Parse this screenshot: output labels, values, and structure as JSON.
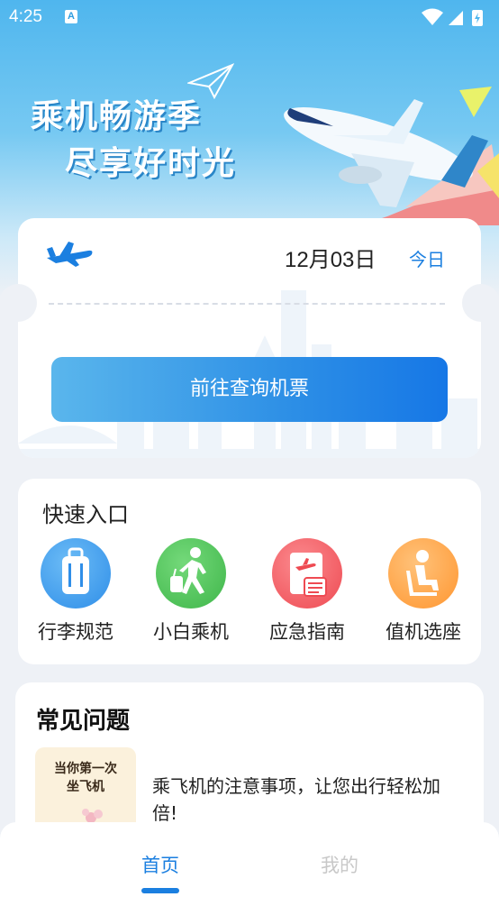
{
  "status_bar": {
    "time": "4:25",
    "notification_badge": "A"
  },
  "banner": {
    "slogan_line1": "乘机畅游季",
    "slogan_line2": "尽享好时光"
  },
  "ticket": {
    "date": "12月03日",
    "today_label": "今日",
    "search_button": "前往查询机票"
  },
  "quick_entry": {
    "title": "快速入口",
    "items": [
      {
        "label": "行李规范",
        "icon": "luggage-icon",
        "color": "#3f9cf0"
      },
      {
        "label": "小白乘机",
        "icon": "walking-passenger-icon",
        "color": "#4cc456"
      },
      {
        "label": "应急指南",
        "icon": "emergency-guide-icon",
        "color": "#f2545b"
      },
      {
        "label": "值机选座",
        "icon": "seat-icon",
        "color": "#ff9c3a"
      }
    ]
  },
  "faq": {
    "title": "常见问题",
    "thumbnail_text": "当你第一次\n坐飞机",
    "item_text": "乘飞机的注意事项，让您出行轻松加倍!"
  },
  "tabbar": {
    "home": "首页",
    "mine": "我的"
  },
  "colors": {
    "accent": "#1b7fe0",
    "hero_sky": "#4fb6ee"
  }
}
